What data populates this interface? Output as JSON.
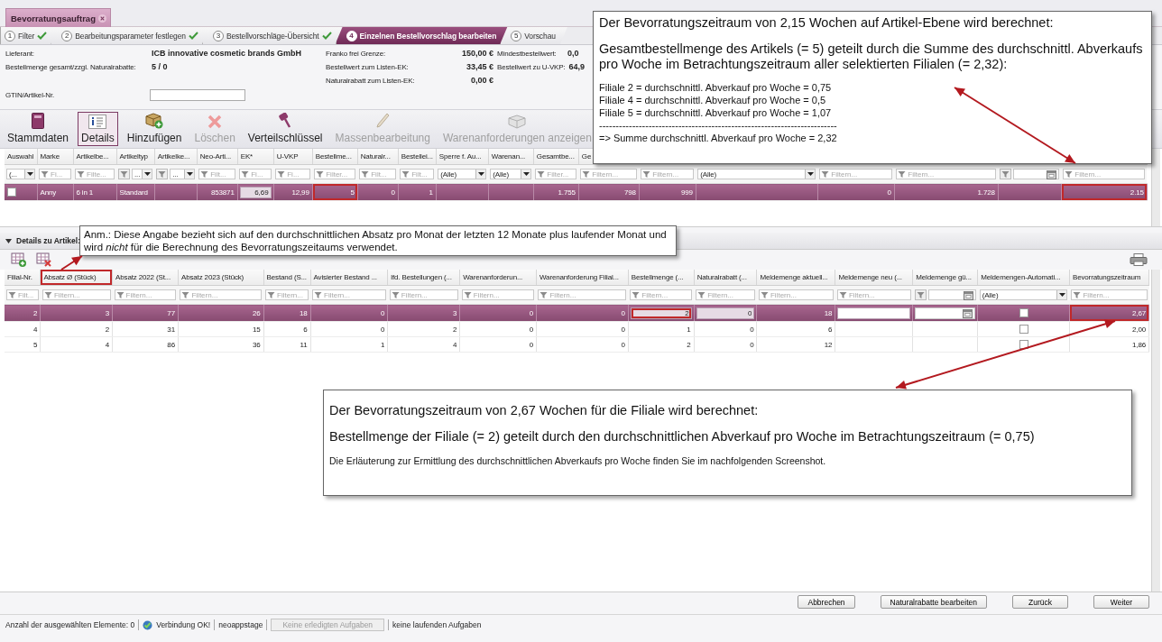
{
  "tab": {
    "title": "Bevorratungsauftrag"
  },
  "steps": [
    {
      "number": "1",
      "label": "Filter",
      "done": true,
      "selected": false
    },
    {
      "number": "2",
      "label": "Bearbeitungsparameter festlegen",
      "done": true,
      "selected": false
    },
    {
      "number": "3",
      "label": "Bestellvorschläge-Übersicht",
      "done": true,
      "selected": false
    },
    {
      "number": "4",
      "label": "Einzelnen Bestellvorschlag bearbeiten",
      "done": false,
      "selected": true
    },
    {
      "number": "5",
      "label": "Vorschau",
      "done": false,
      "selected": false
    }
  ],
  "info_groups": [
    {
      "items": [
        {
          "label": "Lieferant:",
          "value": "ICB innovative cosmetic brands GmbH"
        },
        {
          "label": "Bestellmenge gesamt/zzgl. Naturalrabatte:",
          "value": "5 / 0"
        }
      ]
    },
    {
      "items": [
        {
          "label": "Franko frei Grenze:",
          "value": "150,00 €"
        },
        {
          "label": "Bestellwert zum Listen-EK:",
          "value": "33,45 €"
        },
        {
          "label": "Naturalrabatt zum Listen-EK:",
          "value": "0,00 €"
        }
      ]
    },
    {
      "items": [
        {
          "label": "Mindestbestellwert:",
          "value": "0,0"
        },
        {
          "label": "Bestellwert zu U-VKP:",
          "value": "64,9"
        }
      ]
    }
  ],
  "gtin": {
    "label": "GTIN/Artikel-Nr."
  },
  "toolbar": [
    {
      "label": "Stammdaten",
      "selected": false,
      "disabled": false
    },
    {
      "label": "Details",
      "selected": true,
      "disabled": false
    },
    {
      "label": "Hinzufügen",
      "selected": false,
      "disabled": false
    },
    {
      "label": "Löschen",
      "selected": false,
      "disabled": true
    },
    {
      "label": "Verteilschlüssel",
      "selected": false,
      "disabled": false
    },
    {
      "label": "Massenbearbeitung",
      "selected": false,
      "disabled": true
    },
    {
      "label": "Warenanforderungen anzeigen",
      "selected": false,
      "disabled": true
    }
  ],
  "articles": {
    "columns": [
      {
        "header": "Auswahl",
        "filter": {
          "kind": "select",
          "value": "(..."
        }
      },
      {
        "header": "Marke",
        "filter": {
          "kind": "text",
          "placeholder": "Fi..."
        }
      },
      {
        "header": "Artikelbe...",
        "filter": {
          "kind": "text",
          "placeholder": "Filte..."
        }
      },
      {
        "header": "Artikeltyp",
        "filter": {
          "kind": "funnel-select",
          "value": "..."
        }
      },
      {
        "header": "Artikelke...",
        "filter": {
          "kind": "funnel-select",
          "value": "..."
        }
      },
      {
        "header": "Neo-Arti...",
        "filter": {
          "kind": "text",
          "placeholder": "Filt..."
        }
      },
      {
        "header": "EK*",
        "filter": {
          "kind": "text",
          "placeholder": "Fi..."
        }
      },
      {
        "header": "U-VKP",
        "filter": {
          "kind": "text",
          "placeholder": "Fi..."
        }
      },
      {
        "header": "Bestellme...",
        "filter": {
          "kind": "text",
          "placeholder": "Filter..."
        }
      },
      {
        "header": "Naturalr...",
        "filter": {
          "kind": "text",
          "placeholder": "Filt..."
        }
      },
      {
        "header": "Bestellei...",
        "filter": {
          "kind": "text",
          "placeholder": "Filt..."
        }
      },
      {
        "header": "Sperre f. Au...",
        "filter": {
          "kind": "select",
          "value": "(Alle)"
        }
      },
      {
        "header": "Warenan...",
        "filter": {
          "kind": "select",
          "value": "(Alle)"
        }
      },
      {
        "header": "Gesamtbe...",
        "filter": {
          "kind": "text",
          "placeholder": "Filter..."
        }
      },
      {
        "header": "Ge",
        "filter": {
          "kind": "text",
          "placeholder": "Filtern..."
        }
      },
      {
        "filter": {
          "kind": "text",
          "placeholder": "Filtern..."
        }
      },
      {
        "filter": {
          "kind": "select",
          "value": "(Alle)"
        }
      },
      {
        "filter": {
          "kind": "text",
          "placeholder": "Filtern..."
        }
      },
      {
        "filter": {
          "kind": "text",
          "placeholder": "Filtern..."
        }
      },
      {
        "filter": {
          "kind": "date"
        }
      },
      {
        "filter": {
          "kind": "text",
          "placeholder": "Filtern..."
        }
      }
    ],
    "rows": [
      {
        "selected": true,
        "cells": [
          {
            "kind": "checkbox",
            "checked": false
          },
          "Anny",
          "6 in 1",
          "Standard",
          null,
          "853871",
          {
            "kind": "edit",
            "text": "6,69",
            "highlighted": false
          },
          "12,99",
          {
            "kind": "text",
            "text": "5",
            "highlighted": true
          },
          "0",
          "1",
          null,
          null,
          "1.755",
          "798",
          "999",
          null,
          "0",
          "1.728",
          null,
          {
            "kind": "text",
            "text": "2.15",
            "highlighted": true
          }
        ]
      }
    ]
  },
  "details": {
    "title": "Details zu Artikel:",
    "expanded": true
  },
  "branches": {
    "columns": [
      {
        "header": "Filial-Nr.",
        "filter": {
          "kind": "text",
          "placeholder": "Filt..."
        }
      },
      {
        "header": "Absatz Ø (Stück)",
        "highlighted": true,
        "filter": {
          "kind": "text",
          "placeholder": "Filtern..."
        }
      },
      {
        "header": "Absatz 2022 (St...",
        "filter": {
          "kind": "text",
          "placeholder": "Filtern..."
        }
      },
      {
        "header": "Absatz 2023 (Stück)",
        "filter": {
          "kind": "text",
          "placeholder": "Filtern..."
        }
      },
      {
        "header": "Bestand (S...",
        "filter": {
          "kind": "text",
          "placeholder": "Filtern..."
        }
      },
      {
        "header": "Avisierter Bestand ...",
        "filter": {
          "kind": "text",
          "placeholder": "Filtern..."
        }
      },
      {
        "header": "lfd. Bestellungen (...",
        "filter": {
          "kind": "text",
          "placeholder": "Filtern..."
        }
      },
      {
        "header": "Warenanforderun...",
        "filter": {
          "kind": "text",
          "placeholder": "Filtern..."
        }
      },
      {
        "header": "Warenanforderung Filial...",
        "filter": {
          "kind": "text",
          "placeholder": "Filtern..."
        }
      },
      {
        "header": "Bestellmenge (...",
        "filter": {
          "kind": "text",
          "placeholder": "Filtern..."
        }
      },
      {
        "header": "Naturalrabatt (...",
        "filter": {
          "kind": "text",
          "placeholder": "Filtern..."
        }
      },
      {
        "header": "Meldemenge aktuell...",
        "filter": {
          "kind": "text",
          "placeholder": "Filtern..."
        }
      },
      {
        "header": "Meldemenge neu (...",
        "filter": {
          "kind": "text",
          "placeholder": "Filtern..."
        }
      },
      {
        "header": "Meldemenge gü...",
        "filter": {
          "kind": "date"
        }
      },
      {
        "header": "Meldemengen-Automati...",
        "filter": {
          "kind": "select",
          "value": "(Alle)"
        }
      },
      {
        "header": "Bevorratungszeitraum",
        "filter": {
          "kind": "text",
          "placeholder": "Filtern..."
        }
      }
    ],
    "rows": [
      {
        "selected": true,
        "cells": [
          "2",
          "3",
          "77",
          "26",
          "18",
          "0",
          "3",
          "0",
          "0",
          {
            "kind": "edit",
            "text": "2",
            "highlighted": true
          },
          {
            "kind": "edit",
            "text": "0",
            "highlighted": false
          },
          "18",
          {
            "kind": "input"
          },
          {
            "kind": "date"
          },
          {
            "kind": "checkbox",
            "checked": false
          },
          {
            "kind": "text",
            "text": "2,67",
            "highlighted": true
          }
        ]
      },
      {
        "selected": false,
        "cells": [
          "4",
          "2",
          "31",
          "15",
          "6",
          "0",
          "2",
          "0",
          "0",
          "1",
          "0",
          "6",
          null,
          null,
          {
            "kind": "checkbox",
            "checked": false
          },
          "2,00"
        ]
      },
      {
        "selected": false,
        "cells": [
          "5",
          "4",
          "86",
          "36",
          "11",
          "1",
          "4",
          "0",
          "0",
          "2",
          "0",
          "12",
          null,
          null,
          {
            "kind": "checkbox",
            "checked": false
          },
          "1,86"
        ]
      }
    ]
  },
  "buttons": [
    {
      "label": "Abbrechen"
    },
    {
      "label": "Naturalrabatte bearbeiten"
    },
    {
      "label": "Zurück"
    },
    {
      "label": "Weiter"
    }
  ],
  "status_bar": {
    "selection": "Anzahl der ausgewählten Elemente: 0",
    "connection": "Verbindung OK!",
    "server": "neoappstage",
    "finished_tasks": "Keine erledigten Aufgaben",
    "running_tasks": "keine laufenden Aufgaben"
  },
  "callouts": [
    {
      "lines": [
        {
          "kind": "heading",
          "text": "Der Bevorratungszeitraum von 2,15 Wochen auf Artikel-Ebene wird berechnet:"
        },
        {
          "kind": "heading",
          "text": "Gesamtbestellmenge des Artikels (= 5) geteilt durch die Summe des durchschnittl. Abverkaufs pro Woche im Betrachtungszeitraum aller selektierten Filialen (= 2,32):"
        },
        {
          "kind": "small",
          "text": "Filiale 2 = durchschnittl. Abverkauf pro Woche = 0,75"
        },
        {
          "kind": "small",
          "text": "Filiale 4 = durchschnittl. Abverkauf pro Woche = 0,5"
        },
        {
          "kind": "small",
          "text": "Filiale 5 = durchschnittl. Abverkauf pro Woche = 1,07"
        },
        {
          "kind": "small",
          "text": "------------------------------------------------------------------------"
        },
        {
          "kind": "small",
          "text": "=> Summe durchschnittl. Abverkauf pro Woche = 2,32"
        }
      ]
    },
    {
      "lines": [
        {
          "kind": "body",
          "text": "Anm.: Diese Angabe bezieht sich auf den durchschnittlichen Absatz pro Monat der letzten 12 Monate plus laufender Monat und wird *nicht* für die Berechnung des Bevorratungszeitaums verwendet."
        }
      ]
    },
    {
      "lines": [
        {
          "kind": "heading",
          "text": "Der Bevorratungszeitraum von 2,67 Wochen für die Filiale wird berechnet:"
        },
        {
          "kind": "heading",
          "text": "Bestellmenge der Filiale (= 2) geteilt durch den durchschnittlichen Abverkauf pro Woche im Betrachtungszeitraum (= 0,75)"
        },
        {
          "kind": "small",
          "text": "Die Erläuterung zur Ermittlung des durchschnittlichen Abverkaufs pro Woche finden Sie im nachfolgenden Screenshot."
        }
      ]
    }
  ]
}
